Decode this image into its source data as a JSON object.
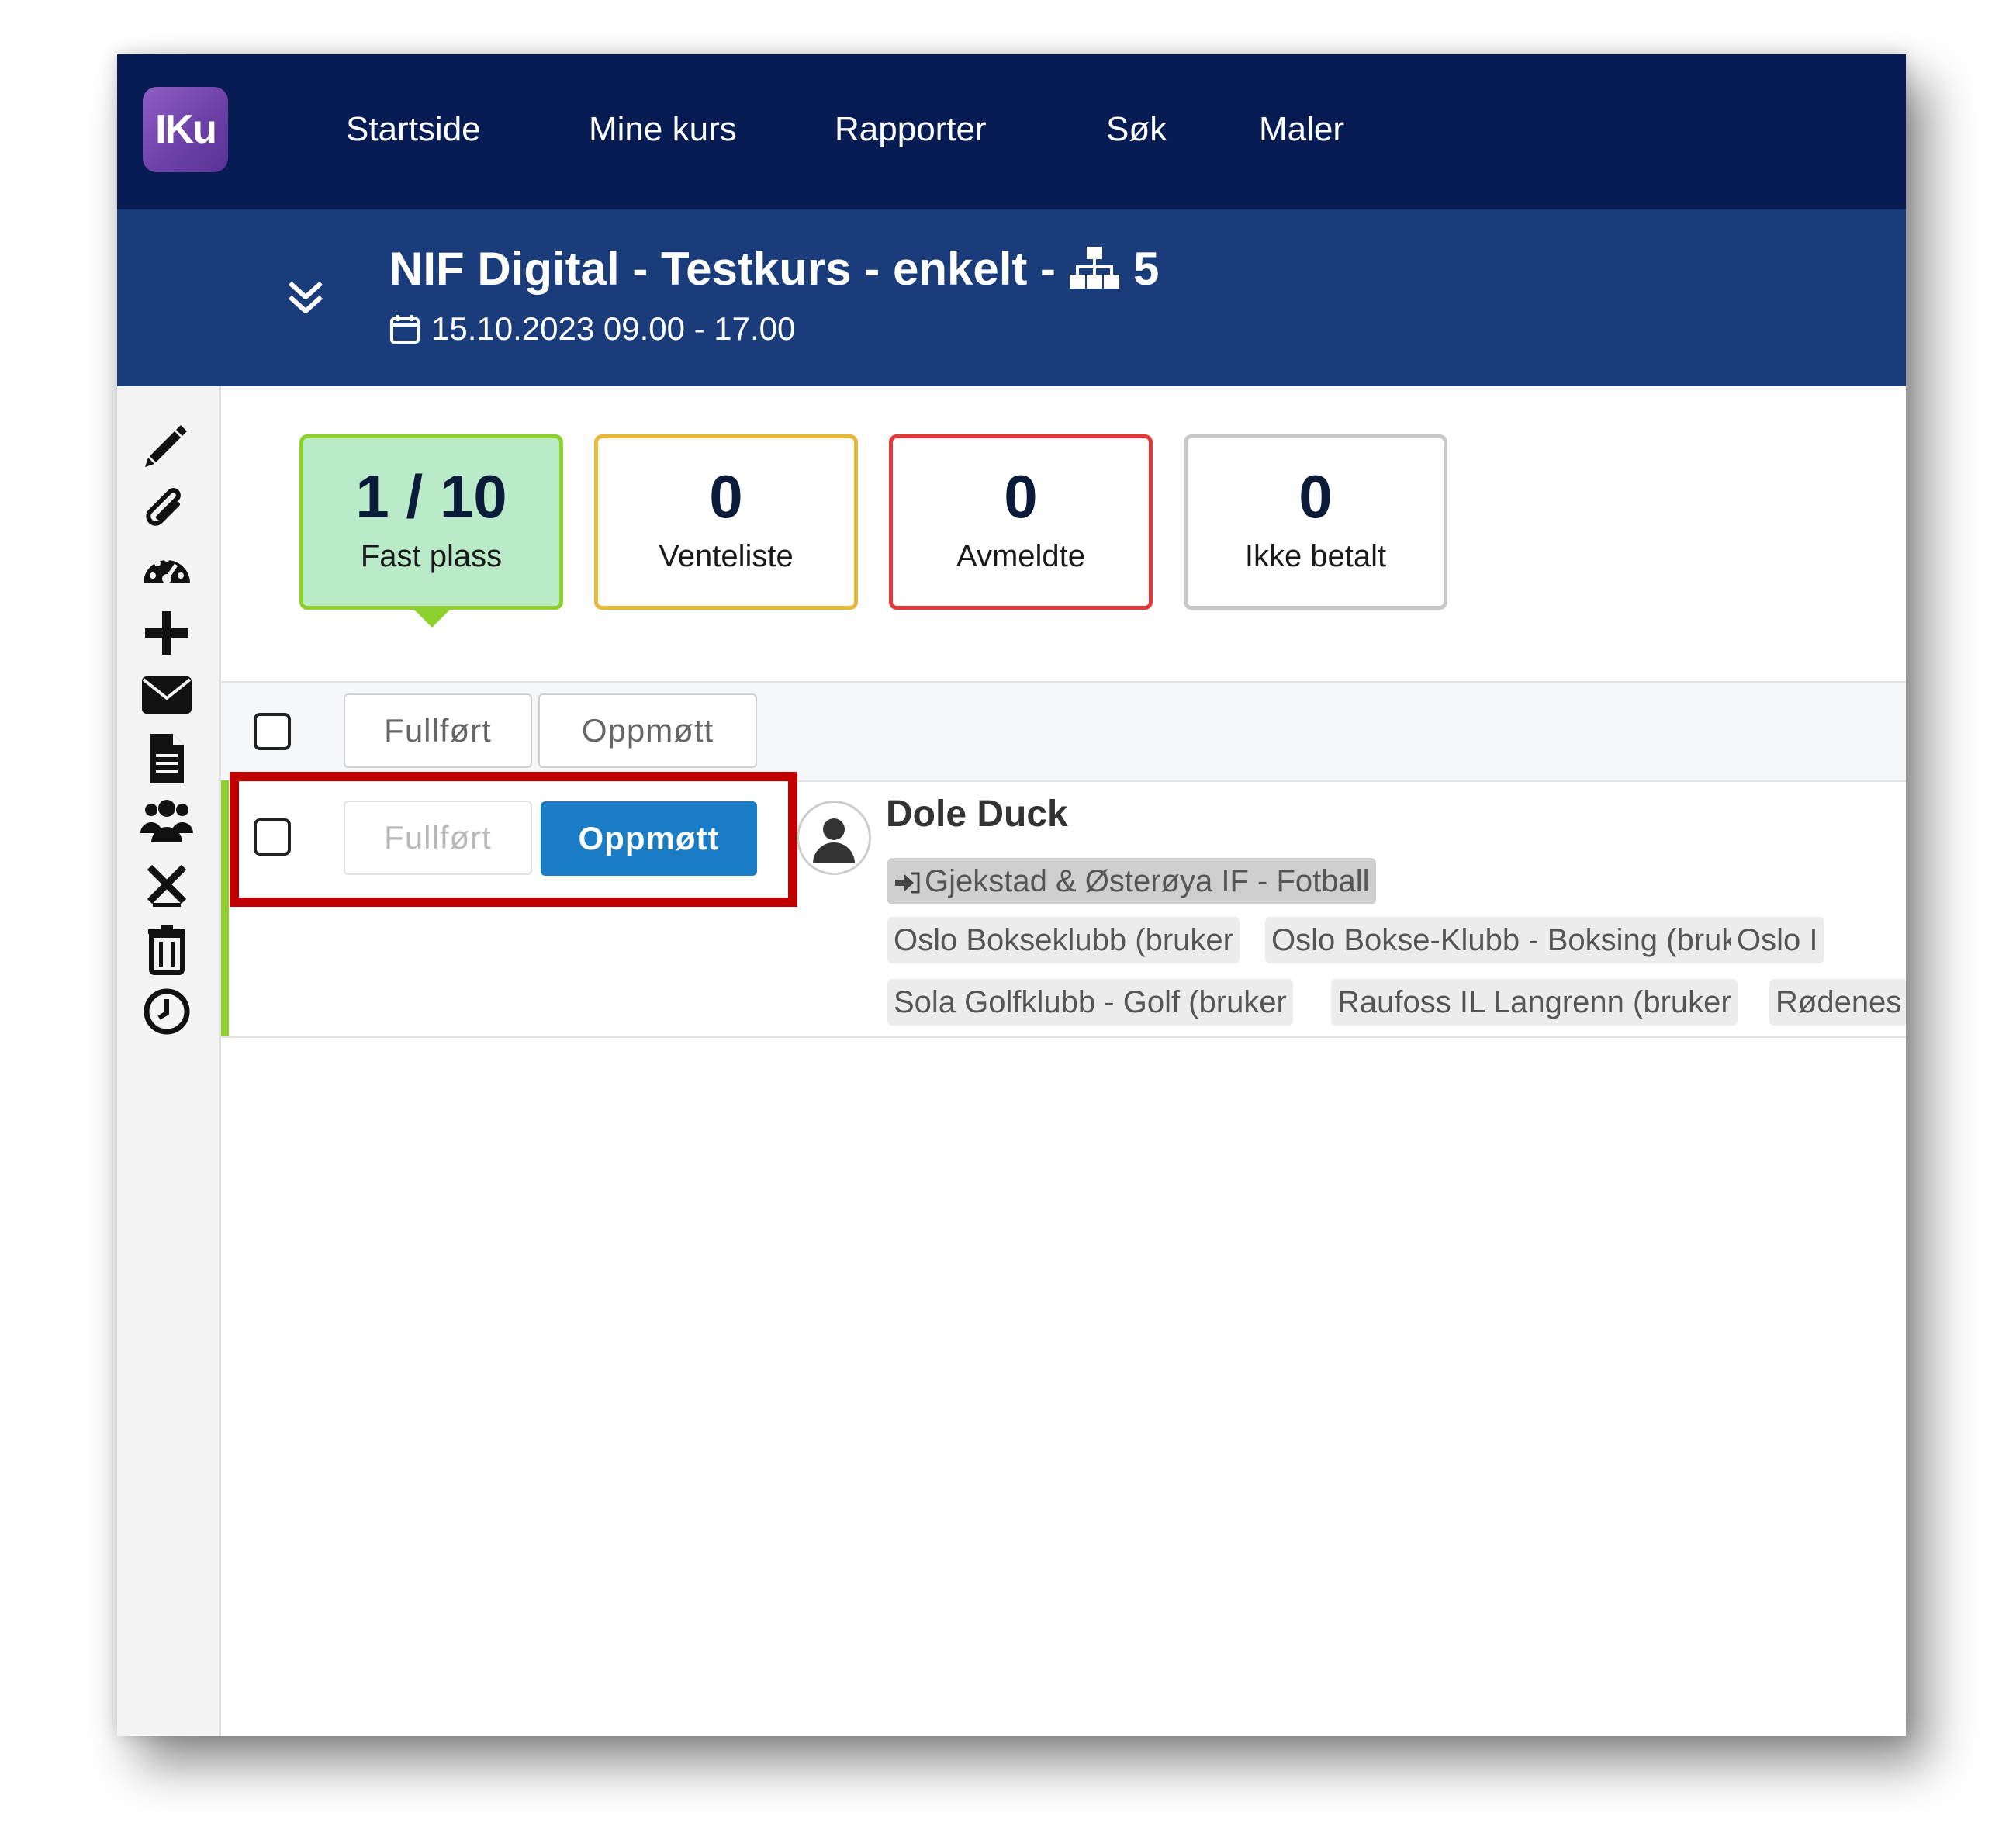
{
  "nav": {
    "logo": "IKu",
    "items": [
      "Startside",
      "Mine kurs",
      "Rapporter",
      "Søk",
      "Maler"
    ]
  },
  "course": {
    "title": "NIF Digital - Testkurs - enkelt -",
    "org_count": "5",
    "date": "15.10.2023 09.00 - 17.00"
  },
  "sidebar": {
    "icons": [
      "pencil-icon",
      "paperclip-icon",
      "dashboard-icon",
      "plus-icon",
      "envelope-icon",
      "document-icon",
      "users-icon",
      "cancel-icon",
      "trash-icon",
      "clock-icon"
    ]
  },
  "stats": [
    {
      "value": "1 / 10",
      "label": "Fast plass",
      "color": "#8ed12f",
      "bg": "#b9ebc8"
    },
    {
      "value": "0",
      "label": "Venteliste",
      "color": "#e7b93a",
      "bg": "#ffffff"
    },
    {
      "value": "0",
      "label": "Avmeldte",
      "color": "#e1393b",
      "bg": "#ffffff"
    },
    {
      "value": "0",
      "label": "Ikke betalt",
      "color": "#c8c8c8",
      "bg": "#ffffff"
    }
  ],
  "toolbar": {
    "completed_label": "Fullført",
    "attended_label": "Oppmøtt"
  },
  "participant": {
    "name": "Dole Duck",
    "completed_label": "Fullført",
    "attended_label": "Oppmøtt",
    "primary_org": "Gjekstad & Østerøya IF - Fotball",
    "orgs_row1": [
      "Oslo Bokseklubb (bruker",
      "Oslo Bokse-Klubb - Boksing (bruker",
      "Oslo I"
    ],
    "orgs_row2": [
      "Sola Golfklubb - Golf (bruker",
      "Raufoss IL Langrenn (bruker",
      "Rødenes"
    ]
  },
  "colors": {
    "topnav": "#061c53",
    "course_header": "#1a3c7b",
    "primary_button": "#1a7cc4",
    "highlight": "#c00000"
  }
}
